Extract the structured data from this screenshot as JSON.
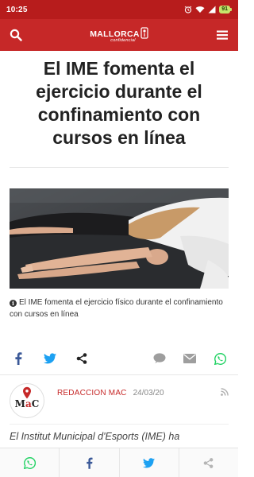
{
  "status_bar": {
    "time": "10:25",
    "battery": "91",
    "icons": [
      "alarm-icon",
      "wifi-icon",
      "signal-icon",
      "battery-icon"
    ]
  },
  "header": {
    "logo_main": "MALLORCA",
    "logo_sub": "confidencial",
    "icons": [
      "search-icon",
      "menu-icon"
    ],
    "color": "#c62828"
  },
  "article": {
    "title": "El IME fomenta el ejercicio durante el confinamiento con cursos en línea",
    "caption": "El IME fomenta el ejercicio físico durante el confinamiento con cursos en línea",
    "author": "REDACCION MAC",
    "date": "24/03/20",
    "body_start": "El Institut Municipal d'Esports (IME) ha"
  },
  "avatar": {
    "prefix": "M",
    "accent": "a",
    "suffix": "C"
  },
  "share": {
    "top": [
      "facebook-icon",
      "twitter-icon",
      "share-icon",
      "comment-icon",
      "email-icon",
      "whatsapp-icon"
    ],
    "bottom": [
      "whatsapp-icon",
      "facebook-icon",
      "twitter-icon",
      "share-icon"
    ]
  },
  "colors": {
    "facebook": "#3b5998",
    "twitter": "#1da1f2",
    "whatsapp": "#25d366",
    "gray": "#9e9e9e"
  }
}
